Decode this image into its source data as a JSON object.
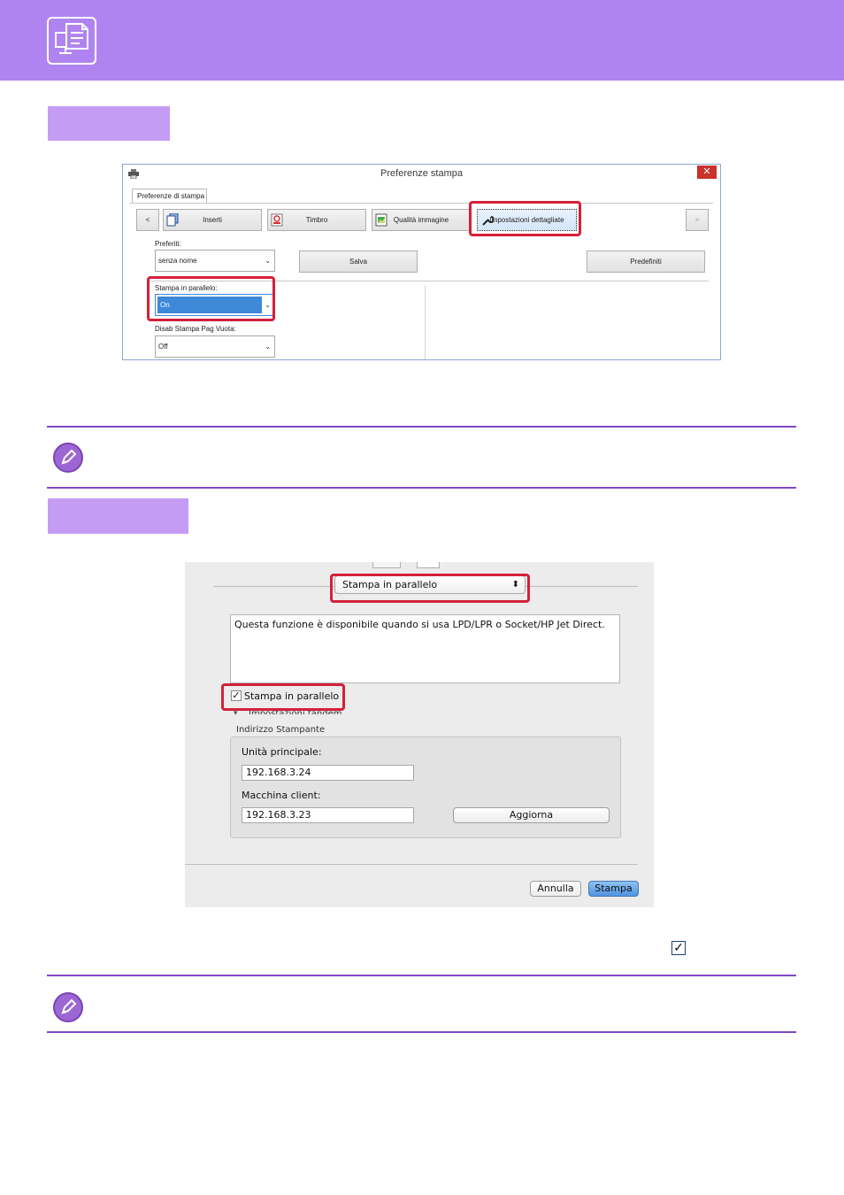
{
  "colors": {
    "header": "#b084f0",
    "section_tab": "#c49cf4",
    "accent_line": "#8048c8",
    "highlight": "#d4203a",
    "selection": "#3e88d8"
  },
  "header": {
    "icon": "printer-document-icon"
  },
  "win_dialog": {
    "title": "Preferenze stampa",
    "close_glyph": "✕",
    "tab_label": "Preferenze di stampa",
    "nav_prev": "<",
    "nav_next": ">",
    "tabs": [
      {
        "label": "Inserti",
        "icon": "pages-icon"
      },
      {
        "label": "Timbro",
        "icon": "stamp-icon"
      },
      {
        "label": "Qualità immagine",
        "icon": "image-quality-icon"
      },
      {
        "label": "Impostazioni dettagliate",
        "icon": "wrench-icon"
      }
    ],
    "favorites_label": "Preferiti:",
    "favorites_value": "senza nome",
    "save_label": "Salva",
    "defaults_label": "Predefiniti",
    "parallel_label": "Stampa in parallelo:",
    "parallel_value": "On",
    "blank_page_label": "Disab Stampa Pag Vuota:",
    "blank_page_value": "Off"
  },
  "mac_dialog": {
    "popup_value": "Stampa in parallelo",
    "popup_arrows": "⬍",
    "description": "Questa funzione è disponibile quando si usa LPD/LPR o Socket/HP Jet Direct.",
    "checkbox_label": "Stampa in parallelo",
    "checkbox_checked": true,
    "checkbox_glyph": "✓",
    "tandem_label": "Impostazioni tandem",
    "printer_address_label": "Indirizzo Stampante",
    "main_unit_label": "Unità principale:",
    "main_unit_value": "192.168.3.24",
    "client_label": "Macchina client:",
    "client_value": "192.168.3.23",
    "update_label": "Aggiorna",
    "cancel_label": "Annulla",
    "print_label": "Stampa"
  },
  "inline_check_glyph": "✓"
}
